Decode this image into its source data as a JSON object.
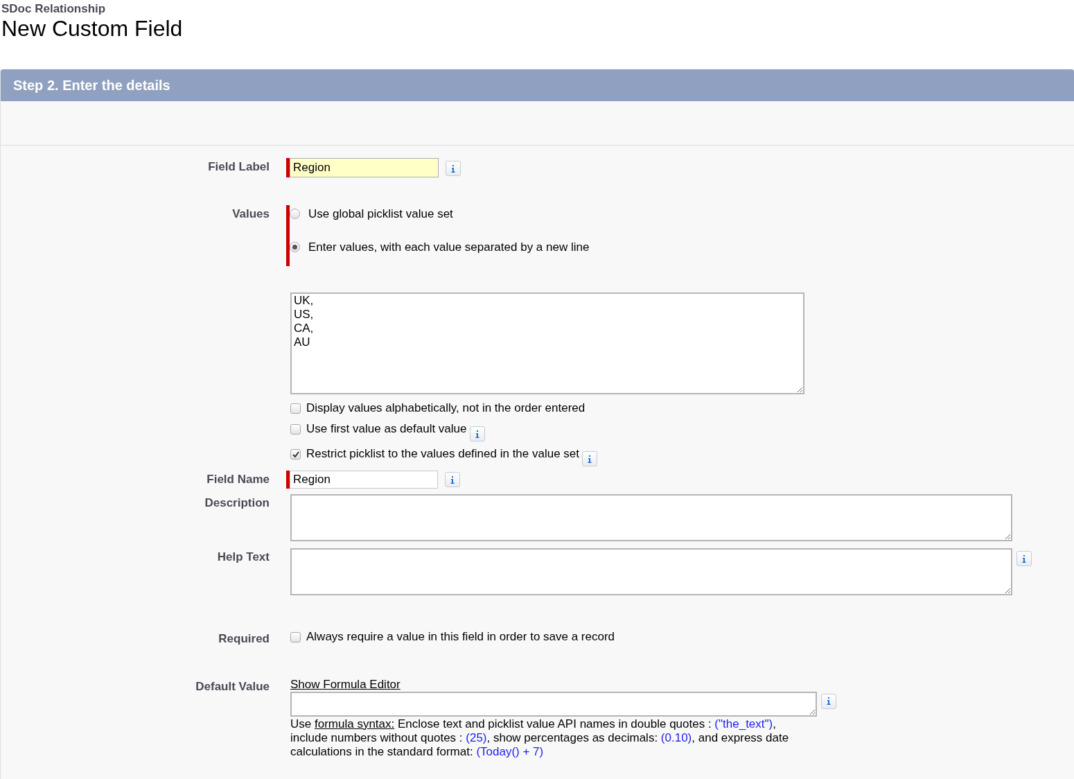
{
  "header": {
    "object_name": "SDoc Relationship",
    "title": "New Custom Field"
  },
  "step": {
    "title": "Step 2. Enter the details"
  },
  "field_label": {
    "label": "Field Label",
    "value": "Region",
    "required": true,
    "highlighted": true
  },
  "values": {
    "label": "Values",
    "required": true,
    "options": [
      {
        "label": "Use global picklist value set",
        "selected": false
      },
      {
        "label": "Enter values, with each value separated by a new line",
        "selected": true
      }
    ],
    "entries": "UK,\nUS,\nCA,\nAU",
    "checkboxes": [
      {
        "label": "Display values alphabetically, not in the order entered",
        "checked": false,
        "info": false
      },
      {
        "label": "Use first value as default value",
        "checked": false,
        "info": true
      },
      {
        "label": "Restrict picklist to the values defined in the value set",
        "checked": true,
        "info": true
      }
    ]
  },
  "field_name": {
    "label": "Field Name",
    "value": "Region",
    "required": true
  },
  "description": {
    "label": "Description"
  },
  "help_text": {
    "label": "Help Text"
  },
  "required": {
    "label": "Required",
    "checkbox": {
      "label": "Always require a value in this field in order to save a record",
      "checked": false
    }
  },
  "default_value": {
    "label": "Default Value",
    "link": "Show Formula Editor",
    "hint": [
      {
        "kind": "plain",
        "text": "Use "
      },
      {
        "kind": "link",
        "text": "formula syntax:"
      },
      {
        "kind": "plain",
        "text": " Enclose text and picklist value API names in double quotes : "
      },
      {
        "kind": "example",
        "text": "(\"the_text\")"
      },
      {
        "kind": "plain",
        "text": ", include numbers without quotes : "
      },
      {
        "kind": "example",
        "text": "(25)"
      },
      {
        "kind": "plain",
        "text": ", show percentages as decimals: "
      },
      {
        "kind": "example",
        "text": "(0.10)"
      },
      {
        "kind": "plain",
        "text": ", and express date calculations in the standard format: "
      },
      {
        "kind": "example",
        "text": "(Today() + 7)"
      }
    ]
  }
}
